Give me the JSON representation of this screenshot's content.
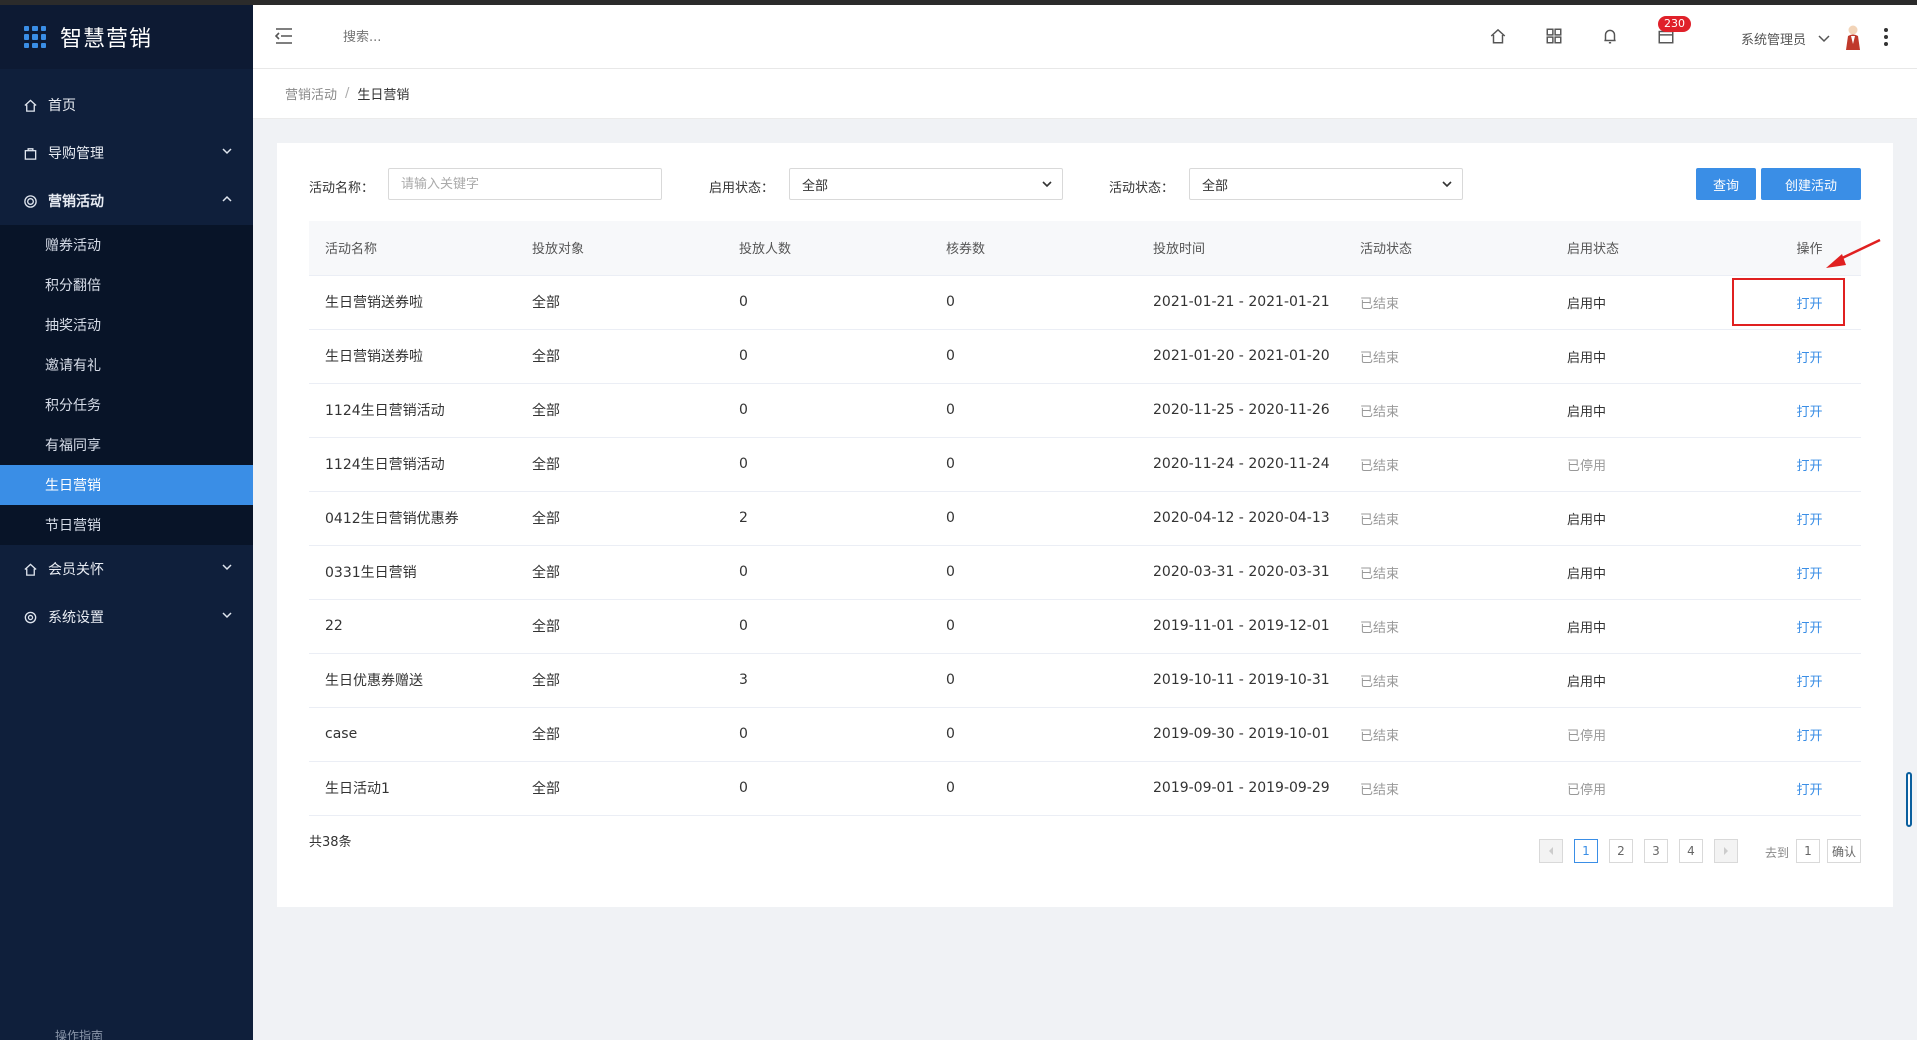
{
  "app": {
    "title": "智慧营销"
  },
  "sidebar": {
    "items": [
      {
        "label": "首页",
        "icon": "home-icon"
      },
      {
        "label": "导购管理",
        "icon": "bag-icon"
      },
      {
        "label": "营销活动",
        "icon": "target-icon"
      },
      {
        "label": "会员关怀",
        "icon": "home-icon"
      },
      {
        "label": "系统设置",
        "icon": "gear-icon"
      }
    ],
    "subitems": [
      {
        "label": "赠券活动"
      },
      {
        "label": "积分翻倍"
      },
      {
        "label": "抽奖活动"
      },
      {
        "label": "邀请有礼"
      },
      {
        "label": "积分任务"
      },
      {
        "label": "有福同享"
      },
      {
        "label": "生日营销"
      },
      {
        "label": "节日营销"
      }
    ],
    "help": "操作指南"
  },
  "header": {
    "search_placeholder": "搜索...",
    "badge": "230",
    "username": "系统管理员"
  },
  "breadcrumb": {
    "parent": "营销活动",
    "current": "生日营销"
  },
  "filters": {
    "name_label": "活动名称：",
    "name_placeholder": "请输入关键字",
    "enable_label": "启用状态：",
    "enable_value": "全部",
    "status_label": "活动状态：",
    "status_value": "全部",
    "query_button": "查询",
    "create_button": "创建活动"
  },
  "table": {
    "columns": [
      "活动名称",
      "投放对象",
      "投放人数",
      "核券数",
      "投放时间",
      "活动状态",
      "启用状态",
      "操作"
    ],
    "rows": [
      {
        "name": "生日营销送券啦",
        "target": "全部",
        "count": "0",
        "verified": "0",
        "time": "2021-01-21 - 2021-01-21",
        "status": "已结束",
        "enabled": "启用中",
        "action": "打开"
      },
      {
        "name": "生日营销送券啦",
        "target": "全部",
        "count": "0",
        "verified": "0",
        "time": "2021-01-20 - 2021-01-20",
        "status": "已结束",
        "enabled": "启用中",
        "action": "打开"
      },
      {
        "name": "1124生日营销活动",
        "target": "全部",
        "count": "0",
        "verified": "0",
        "time": "2020-11-25 - 2020-11-26",
        "status": "已结束",
        "enabled": "启用中",
        "action": "打开"
      },
      {
        "name": "1124生日营销活动",
        "target": "全部",
        "count": "0",
        "verified": "0",
        "time": "2020-11-24 - 2020-11-24",
        "status": "已结束",
        "enabled": "已停用",
        "action": "打开"
      },
      {
        "name": "0412生日营销优惠券",
        "target": "全部",
        "count": "2",
        "verified": "0",
        "time": "2020-04-12 - 2020-04-13",
        "status": "已结束",
        "enabled": "启用中",
        "action": "打开"
      },
      {
        "name": "0331生日营销",
        "target": "全部",
        "count": "0",
        "verified": "0",
        "time": "2020-03-31 - 2020-03-31",
        "status": "已结束",
        "enabled": "启用中",
        "action": "打开"
      },
      {
        "name": "22",
        "target": "全部",
        "count": "0",
        "verified": "0",
        "time": "2019-11-01 - 2019-12-01",
        "status": "已结束",
        "enabled": "启用中",
        "action": "打开"
      },
      {
        "name": "生日优惠券赠送",
        "target": "全部",
        "count": "3",
        "verified": "0",
        "time": "2019-10-11 - 2019-10-31",
        "status": "已结束",
        "enabled": "启用中",
        "action": "打开"
      },
      {
        "name": "case",
        "target": "全部",
        "count": "0",
        "verified": "0",
        "time": "2019-09-30 - 2019-10-01",
        "status": "已结束",
        "enabled": "已停用",
        "action": "打开"
      },
      {
        "name": "生日活动1",
        "target": "全部",
        "count": "0",
        "verified": "0",
        "time": "2019-09-01 - 2019-09-29",
        "status": "已结束",
        "enabled": "已停用",
        "action": "打开"
      }
    ]
  },
  "footer": {
    "total": "共38条",
    "pages": [
      "1",
      "2",
      "3",
      "4"
    ],
    "current_page": "1",
    "goto_label": "去到",
    "goto_value": "1",
    "confirm": "确认"
  },
  "colors": {
    "sidebar": "#0f1f3b",
    "accent": "#3a8ee6",
    "highlight": "#e02020"
  }
}
